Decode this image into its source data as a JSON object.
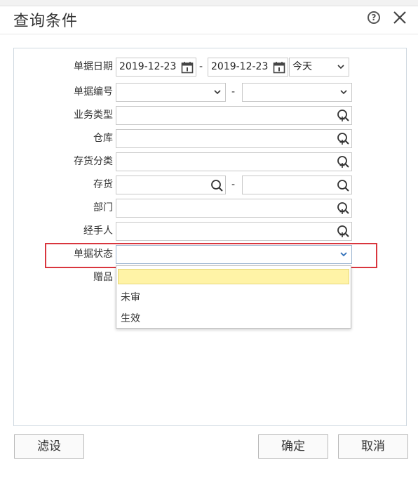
{
  "dialog": {
    "title": "查询条件",
    "help_glyph": "?",
    "help_icon": "help-circle-icon",
    "close_icon": "close-icon"
  },
  "form": {
    "date": {
      "label": "单据日期",
      "from": "2019-12-23",
      "to": "2019-12-23",
      "separator": "-",
      "range": "今天"
    },
    "doc_no": {
      "label": "单据编号",
      "from": "",
      "to": "",
      "separator": "-"
    },
    "biz_type": {
      "label": "业务类型",
      "value": ""
    },
    "warehouse": {
      "label": "仓库",
      "value": ""
    },
    "inventory_class": {
      "label": "存货分类",
      "value": ""
    },
    "inventory": {
      "label": "存货",
      "from": "",
      "to": "",
      "separator": "-"
    },
    "department": {
      "label": "部门",
      "value": ""
    },
    "handler": {
      "label": "经手人",
      "value": ""
    },
    "doc_status": {
      "label": "单据状态",
      "value": ""
    },
    "gift": {
      "label": "赠品"
    }
  },
  "status_dropdown": {
    "options": [
      "",
      "未审",
      "生效"
    ]
  },
  "buttons": {
    "filter_settings": "滤设",
    "confirm": "确定",
    "cancel": "取消"
  },
  "colors": {
    "highlight": "#d9363e",
    "selected_option": "#fff3a6",
    "chevron_blue": "#2f6fb8"
  }
}
